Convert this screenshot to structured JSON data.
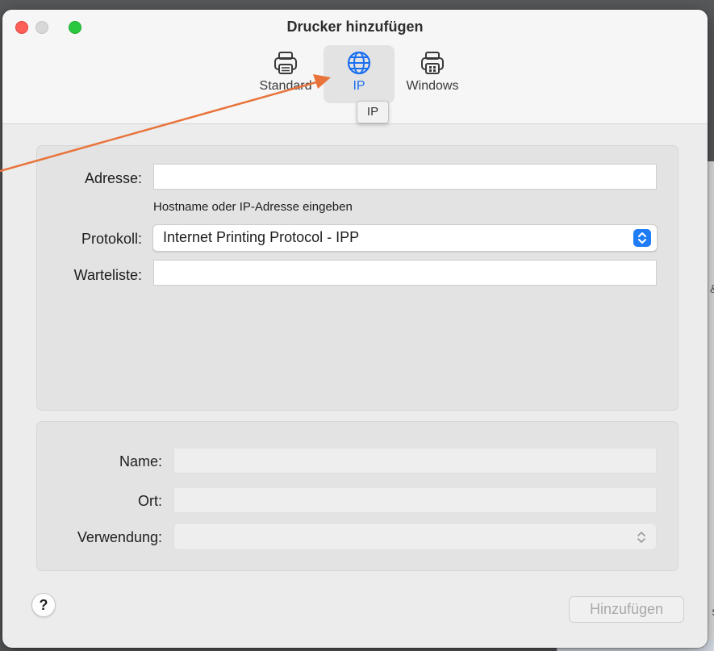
{
  "window": {
    "title": "Drucker hinzufügen"
  },
  "toolbar": {
    "items": [
      {
        "label": "Standard",
        "icon": "printer-icon"
      },
      {
        "label": "IP",
        "icon": "globe-icon",
        "selected": true
      },
      {
        "label": "Windows",
        "icon": "windows-printer-icon"
      }
    ],
    "tooltip": "IP"
  },
  "ip_form": {
    "address_label": "Adresse:",
    "address_value": "",
    "address_hint": "Hostname oder IP-Adresse eingeben",
    "protocol_label": "Protokoll:",
    "protocol_value": "Internet Printing Protocol - IPP",
    "queue_label": "Warteliste:",
    "queue_value": ""
  },
  "details": {
    "name_label": "Name:",
    "location_label": "Ort:",
    "use_label": "Verwendung:"
  },
  "footer": {
    "help_label": "?",
    "add_label": "Hinzufügen"
  },
  "colors": {
    "accent": "#1f7cf5",
    "annotation_arrow": "#e8743b",
    "close": "#fe5f57",
    "maximize": "#2ac840"
  }
}
